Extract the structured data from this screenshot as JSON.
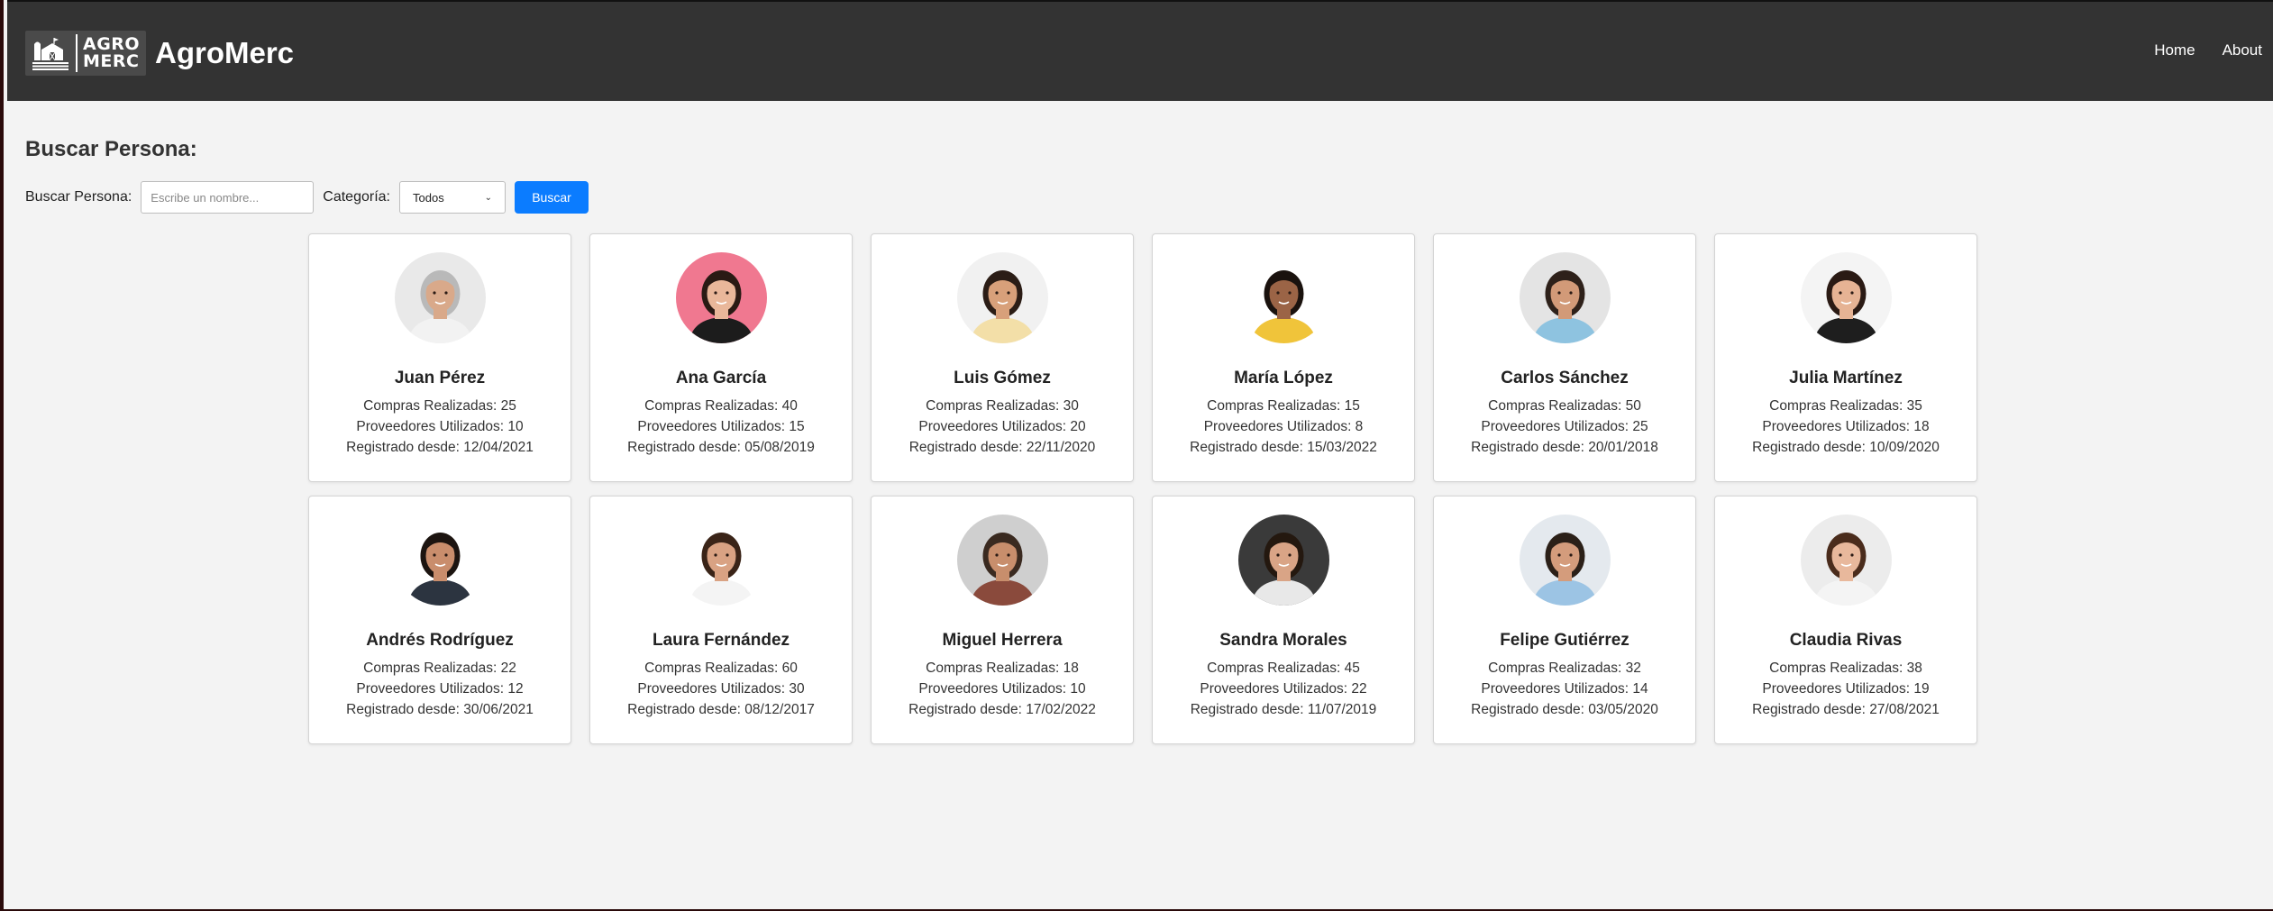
{
  "header": {
    "logo_line1": "AGRO",
    "logo_line2": "MERC",
    "brand": "AgroMerc",
    "nav": [
      {
        "label": "Home"
      },
      {
        "label": "About"
      }
    ]
  },
  "search": {
    "title": "Buscar Persona:",
    "label": "Buscar Persona:",
    "placeholder": "Escribe un nombre...",
    "category_label": "Categoría:",
    "category_selected": "Todos",
    "button": "Buscar"
  },
  "persons": [
    {
      "name": "Juan Pérez",
      "purchases": "Compras Realizadas: 25",
      "providers": "Proveedores Utilizados: 10",
      "since": "Registrado desde: 12/04/2021",
      "bg": "#e9e9e9",
      "skin": "#d9a98a",
      "hair": "#b9b9b9",
      "shirt": "#f2f2f2"
    },
    {
      "name": "Ana García",
      "purchases": "Compras Realizadas: 40",
      "providers": "Proveedores Utilizados: 15",
      "since": "Registrado desde: 05/08/2019",
      "bg": "#f07890",
      "skin": "#e9b79a",
      "hair": "#2a1a14",
      "shirt": "#1c1c1c"
    },
    {
      "name": "Luis Gómez",
      "purchases": "Compras Realizadas: 30",
      "providers": "Proveedores Utilizados: 20",
      "since": "Registrado desde: 22/11/2020",
      "bg": "#f1f1f1",
      "skin": "#d8a07a",
      "hair": "#2b1d16",
      "shirt": "#f3dfa8"
    },
    {
      "name": "María López",
      "purchases": "Compras Realizadas: 15",
      "providers": "Proveedores Utilizados: 8",
      "since": "Registrado desde: 15/03/2022",
      "bg": "#ffffff",
      "skin": "#9b6446",
      "hair": "#1a120e",
      "shirt": "#f0c43a"
    },
    {
      "name": "Carlos Sánchez",
      "purchases": "Compras Realizadas: 50",
      "providers": "Proveedores Utilizados: 25",
      "since": "Registrado desde: 20/01/2018",
      "bg": "#e4e4e4",
      "skin": "#d29a78",
      "hair": "#2e211a",
      "shirt": "#8ec3e0"
    },
    {
      "name": "Julia Martínez",
      "purchases": "Compras Realizadas: 35",
      "providers": "Proveedores Utilizados: 18",
      "since": "Registrado desde: 10/09/2020",
      "bg": "#f4f4f4",
      "skin": "#e6b394",
      "hair": "#2a1a14",
      "shirt": "#1e1e1e"
    },
    {
      "name": "Andrés Rodríguez",
      "purchases": "Compras Realizadas: 22",
      "providers": "Proveedores Utilizados: 12",
      "since": "Registrado desde: 30/06/2021",
      "bg": "#ffffff",
      "skin": "#c98d6c",
      "hair": "#1c1410",
      "shirt": "#2c3440"
    },
    {
      "name": "Laura Fernández",
      "purchases": "Compras Realizadas: 60",
      "providers": "Proveedores Utilizados: 30",
      "since": "Registrado desde: 08/12/2017",
      "bg": "#ffffff",
      "skin": "#d9a283",
      "hair": "#3a2418",
      "shirt": "#f4f4f4"
    },
    {
      "name": "Miguel Herrera",
      "purchases": "Compras Realizadas: 18",
      "providers": "Proveedores Utilizados: 10",
      "since": "Registrado desde: 17/02/2022",
      "bg": "#cfcfcf",
      "skin": "#c88e6c",
      "hair": "#3a2a20",
      "shirt": "#8a4a3c"
    },
    {
      "name": "Sandra Morales",
      "purchases": "Compras Realizadas: 45",
      "providers": "Proveedores Utilizados: 22",
      "since": "Registrado desde: 11/07/2019",
      "bg": "#3a3a3a",
      "skin": "#d9a486",
      "hair": "#24180f",
      "shirt": "#e8e8e8"
    },
    {
      "name": "Felipe Gutiérrez",
      "purchases": "Compras Realizadas: 32",
      "providers": "Proveedores Utilizados: 14",
      "since": "Registrado desde: 03/05/2020",
      "bg": "#e4e9ee",
      "skin": "#d49c7c",
      "hair": "#2b2018",
      "shirt": "#9cc4e4"
    },
    {
      "name": "Claudia Rivas",
      "purchases": "Compras Realizadas: 38",
      "providers": "Proveedores Utilizados: 19",
      "since": "Registrado desde: 27/08/2021",
      "bg": "#ececec",
      "skin": "#e8b89c",
      "hair": "#4a2c1c",
      "shirt": "#f4f4f4"
    }
  ],
  "colors": {
    "header_bg": "#333333",
    "page_bg": "#f3f3f3",
    "primary_button": "#0b7cff"
  }
}
